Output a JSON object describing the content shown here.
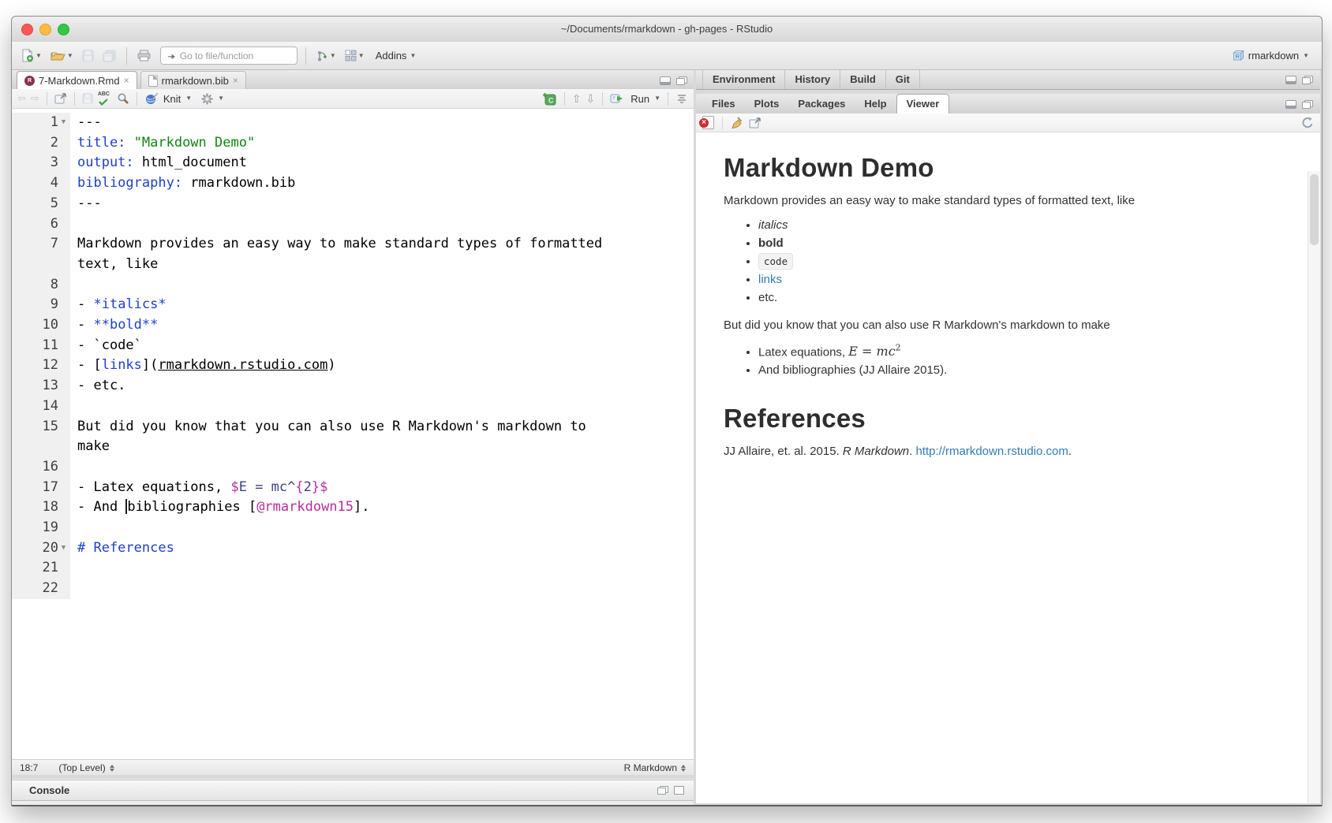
{
  "window": {
    "title": "~/Documents/rmarkdown - gh-pages - RStudio"
  },
  "toolbar": {
    "goto_placeholder": "Go to file/function",
    "addins_label": "Addins",
    "project_label": "rmarkdown"
  },
  "editor": {
    "tabs": [
      {
        "label": "7-Markdown.Rmd",
        "icon": "rmd",
        "active": true
      },
      {
        "label": "rmarkdown.bib",
        "icon": "page",
        "active": false
      }
    ],
    "toolbar": {
      "knit_label": "Knit",
      "run_label": "Run"
    },
    "status": {
      "position": "18:7",
      "scope": "(Top Level)",
      "mode": "R Markdown"
    },
    "lines": [
      {
        "n": 1,
        "fold": true,
        "rows": [
          [
            {
              "t": "---",
              "c": "pl"
            }
          ]
        ]
      },
      {
        "n": 2,
        "rows": [
          [
            {
              "t": "title: ",
              "c": "key"
            },
            {
              "t": "\"Markdown Demo\"",
              "c": "str"
            }
          ]
        ]
      },
      {
        "n": 3,
        "rows": [
          [
            {
              "t": "output: ",
              "c": "key"
            },
            {
              "t": "html_document",
              "c": "pl"
            }
          ]
        ]
      },
      {
        "n": 4,
        "rows": [
          [
            {
              "t": "bibliography: ",
              "c": "key"
            },
            {
              "t": "rmarkdown.bib",
              "c": "pl"
            }
          ]
        ]
      },
      {
        "n": 5,
        "rows": [
          [
            {
              "t": "---",
              "c": "pl"
            }
          ]
        ]
      },
      {
        "n": 6,
        "rows": [
          []
        ]
      },
      {
        "n": 7,
        "rows": [
          [
            {
              "t": "Markdown provides an easy way to make standard types of formatted",
              "c": "pl"
            }
          ],
          [
            {
              "t": "text, like",
              "c": "pl"
            }
          ]
        ]
      },
      {
        "n": 8,
        "rows": [
          []
        ]
      },
      {
        "n": 9,
        "rows": [
          [
            {
              "t": "- ",
              "c": "pl"
            },
            {
              "t": "*italics*",
              "c": "em"
            }
          ]
        ]
      },
      {
        "n": 10,
        "rows": [
          [
            {
              "t": "- ",
              "c": "pl"
            },
            {
              "t": "**bold**",
              "c": "em"
            }
          ]
        ]
      },
      {
        "n": 11,
        "rows": [
          [
            {
              "t": "- `code`",
              "c": "pl"
            }
          ]
        ]
      },
      {
        "n": 12,
        "rows": [
          [
            {
              "t": "- [",
              "c": "pl"
            },
            {
              "t": "links",
              "c": "em"
            },
            {
              "t": "](",
              "c": "pl"
            },
            {
              "t": "rmarkdown.rstudio.com",
              "c": "und"
            },
            {
              "t": ")",
              "c": "pl"
            }
          ]
        ]
      },
      {
        "n": 13,
        "rows": [
          [
            {
              "t": "- etc.",
              "c": "pl"
            }
          ]
        ]
      },
      {
        "n": 14,
        "rows": [
          []
        ]
      },
      {
        "n": 15,
        "rows": [
          [
            {
              "t": "But did you know that you can also use R Markdown's markdown to",
              "c": "pl"
            }
          ],
          [
            {
              "t": "make",
              "c": "pl"
            }
          ]
        ]
      },
      {
        "n": 16,
        "rows": [
          []
        ]
      },
      {
        "n": 17,
        "rows": [
          [
            {
              "t": "- Latex equations, ",
              "c": "pl"
            },
            {
              "t": "$",
              "c": "mathd"
            },
            {
              "t": "E = mc^",
              "c": "math"
            },
            {
              "t": "{",
              "c": "mathd"
            },
            {
              "t": "2",
              "c": "math"
            },
            {
              "t": "}",
              "c": "mathd"
            },
            {
              "t": "$",
              "c": "mathd"
            }
          ]
        ]
      },
      {
        "n": 18,
        "rows": [
          [
            {
              "t": "- And ",
              "c": "pl"
            },
            {
              "t": "",
              "c": "cursor"
            },
            {
              "t": "bibliographies [",
              "c": "pl"
            },
            {
              "t": "@rmarkdown15",
              "c": "cite"
            },
            {
              "t": "].",
              "c": "pl"
            }
          ]
        ]
      },
      {
        "n": 19,
        "rows": [
          []
        ]
      },
      {
        "n": 20,
        "fold": true,
        "rows": [
          [
            {
              "t": "# References",
              "c": "em"
            }
          ]
        ]
      },
      {
        "n": 21,
        "rows": [
          []
        ]
      },
      {
        "n": 22,
        "rows": [
          []
        ]
      }
    ]
  },
  "console": {
    "label": "Console"
  },
  "panes": {
    "top_tabs": [
      "Environment",
      "History",
      "Build",
      "Git"
    ],
    "bottom_tabs": [
      "Files",
      "Plots",
      "Packages",
      "Help",
      "Viewer"
    ],
    "active_bottom_tab": "Viewer"
  },
  "viewer": {
    "h1": "Markdown Demo",
    "p1": "Markdown provides an easy way to make standard types of formatted text, like",
    "list1": [
      {
        "text": "italics",
        "style": "italic"
      },
      {
        "text": "bold",
        "style": "bold"
      },
      {
        "text": "code",
        "style": "code"
      },
      {
        "text": "links",
        "style": "link"
      },
      {
        "text": "etc.",
        "style": "plain"
      }
    ],
    "p2": "But did you know that you can also use R Markdown's markdown to make",
    "math_item": {
      "prefix": "Latex equations, ",
      "e": "E",
      "eq": " = ",
      "mc": "mc",
      "sup": "2"
    },
    "bib_item": "And bibliographies (JJ Allaire 2015).",
    "h2": "References",
    "reference": {
      "prefix": "JJ Allaire, et. al. 2015. ",
      "title": "R Markdown",
      "sep": ". ",
      "link": "http://rmarkdown.rstudio.com",
      "suffix": "."
    }
  },
  "colors": {
    "yaml_key_blue": "#1d3fcc",
    "string_green": "#118411",
    "markdown_blue": "#1d3fcc",
    "magenta": "#bb2c9a",
    "math_navy": "#3c4182",
    "viewer_link_blue": "#337ab7",
    "traffic_red": "#fc5753",
    "traffic_yellow": "#fdbc40",
    "traffic_green": "#33c748"
  }
}
